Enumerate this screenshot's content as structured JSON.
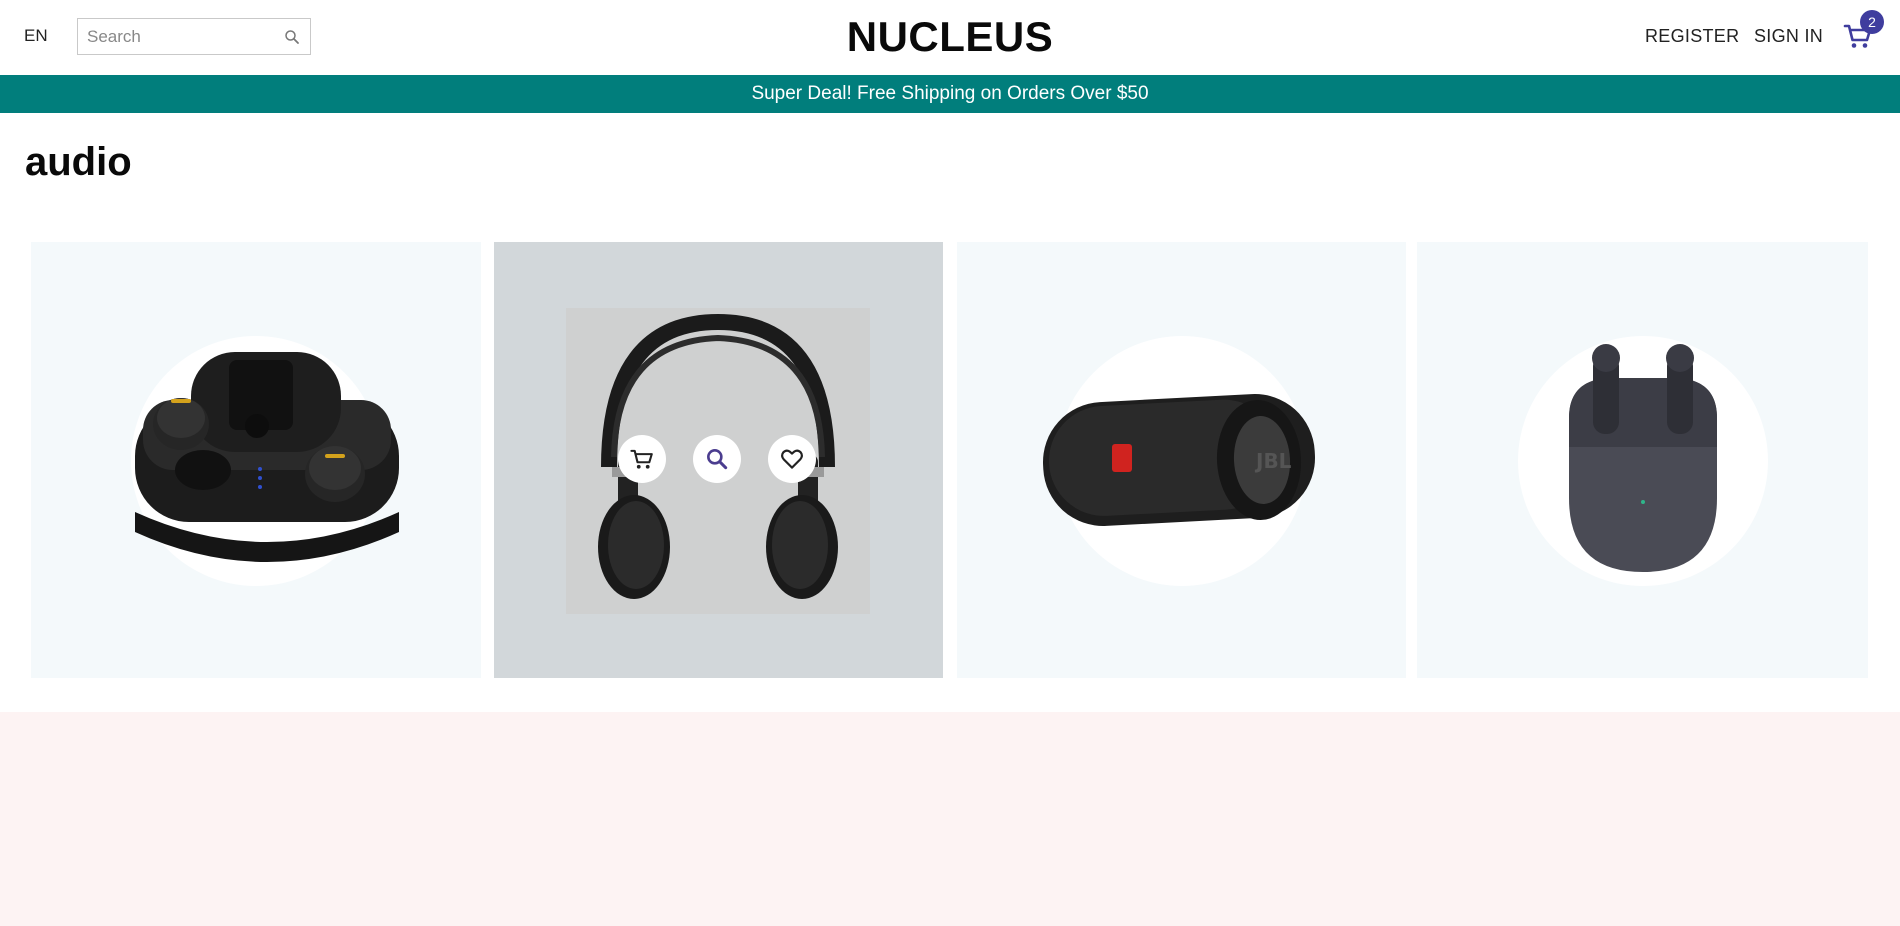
{
  "header": {
    "language": "EN",
    "search_placeholder": "Search",
    "logo": "NUCLEUS",
    "register": "REGISTER",
    "sign_in": "SIGN IN",
    "cart_count": "2",
    "cart_icon": "shopping-cart-icon",
    "search_icon": "search-icon"
  },
  "promo": {
    "text": "Super Deal! Free Shipping on Orders Over $50"
  },
  "page": {
    "title": "audio"
  },
  "products": [
    {
      "name": "true-wireless-earbuds-case",
      "hovered": false
    },
    {
      "name": "on-ear-headphones",
      "hovered": true
    },
    {
      "name": "jbl-portable-speaker",
      "hovered": false
    },
    {
      "name": "wireless-earbuds-grey-case",
      "hovered": false
    }
  ],
  "product_actions": {
    "add_to_cart_icon": "cart-icon",
    "quick_view_icon": "search-icon",
    "wishlist_icon": "heart-icon"
  },
  "colors": {
    "accent_teal": "#017e7c",
    "badge": "#3f3d9e",
    "card_bg": "#f4f9fb",
    "card_hover_bg": "#d2d7da",
    "footer_bg": "#fdf3f3"
  }
}
